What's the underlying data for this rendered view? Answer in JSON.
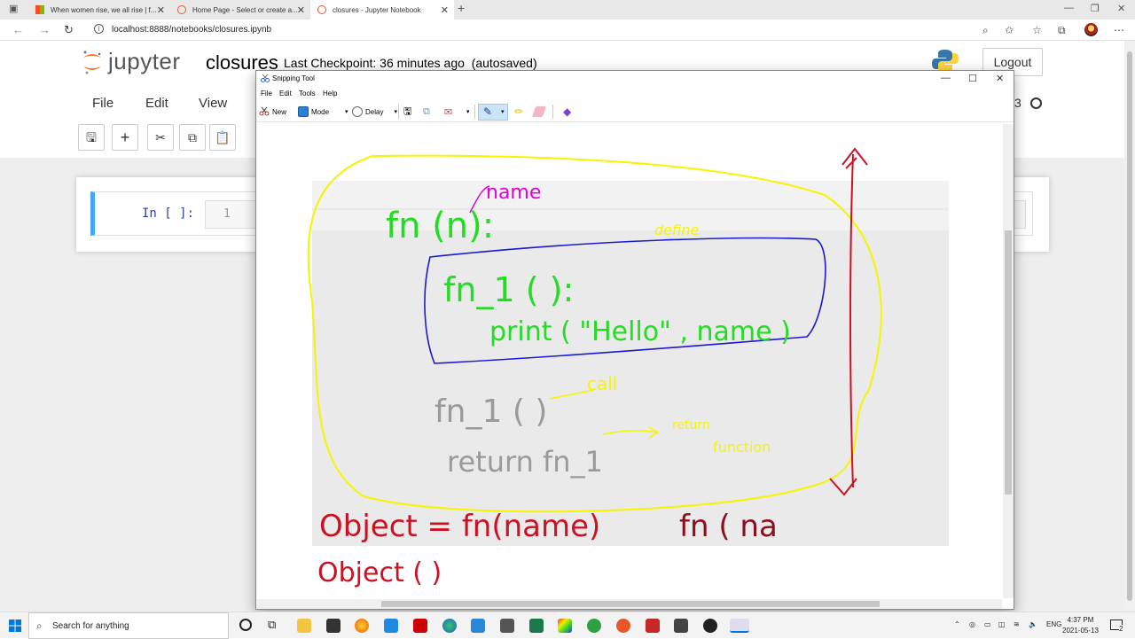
{
  "browser": {
    "tabs": [
      {
        "title": "When women rise, we all rise | f..."
      },
      {
        "title": "Home Page - Select or create a..."
      },
      {
        "title": "closures - Jupyter Notebook"
      }
    ],
    "url": "localhost:8888/notebooks/closures.ipynb"
  },
  "jupyter": {
    "logo_text": "jupyter",
    "notebook_name": "closures",
    "checkpoint": "Last Checkpoint: 36 minutes ago",
    "autosave": "(autosaved)",
    "logout_label": "Logout",
    "menus": [
      "File",
      "Edit",
      "View"
    ],
    "kernel_fragment": "3",
    "cell": {
      "prompt": "In [ ]:",
      "line_number": "1"
    }
  },
  "snipping_tool": {
    "title": "Snipping Tool",
    "menu": [
      "File",
      "Edit",
      "Tools",
      "Help"
    ],
    "toolbar": {
      "new": "New",
      "mode": "Mode",
      "delay": "Delay"
    },
    "ink_text": {
      "name_label": "name",
      "fn_def": "fn (n):",
      "define": "define",
      "inner_def": "fn_1 ( ):",
      "print_stmt": "print ( \"Hello\" , name )",
      "call_stmt": "fn_1 ( )",
      "call_note": "call",
      "return_stmt": "return fn_1",
      "return_note_1": "return",
      "return_note_2": "function",
      "assign_stmt": "Object = fn(name)",
      "partial_call": "fn ( na",
      "object_call": "Object ( )"
    },
    "ink_colors": {
      "yellow": "#f5f500",
      "green": "#22dd22",
      "blue": "#1a1ad0",
      "magenta": "#e000e0",
      "red": "#cc1122",
      "gray": "#9a9a9a"
    }
  },
  "taskbar": {
    "search_placeholder": "Search for anything",
    "language": "ENG",
    "time": "4:37 PM",
    "date": "2021-05-13",
    "notification_count": "2"
  }
}
